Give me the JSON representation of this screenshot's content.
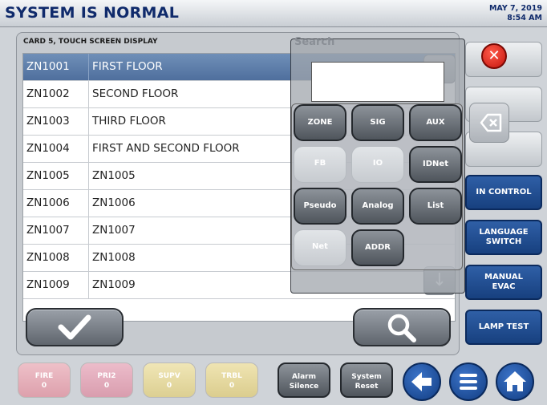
{
  "header": {
    "status": "SYSTEM IS NORMAL",
    "date": "MAY 7, 2019",
    "time": "8:54 AM"
  },
  "panel": {
    "title": "CARD 5, TOUCH SCREEN DISPLAY",
    "rows": [
      {
        "id": "ZN1001",
        "desc": "FIRST FLOOR",
        "selected": true
      },
      {
        "id": "ZN1002",
        "desc": "SECOND FLOOR"
      },
      {
        "id": "ZN1003",
        "desc": "THIRD FLOOR"
      },
      {
        "id": "ZN1004",
        "desc": "FIRST AND SECOND FLOOR"
      },
      {
        "id": "ZN1005",
        "desc": "ZN1005"
      },
      {
        "id": "ZN1006",
        "desc": "ZN1006"
      },
      {
        "id": "ZN1007",
        "desc": "ZN1007"
      },
      {
        "id": "ZN1008",
        "desc": "ZN1008"
      },
      {
        "id": "ZN1009",
        "desc": "ZN1009"
      }
    ]
  },
  "search": {
    "label": "Search",
    "value": "",
    "keys": [
      {
        "label": "ZONE",
        "enabled": true
      },
      {
        "label": "SIG",
        "enabled": true
      },
      {
        "label": "AUX",
        "enabled": true
      },
      {
        "label": "FB",
        "enabled": false
      },
      {
        "label": "IO",
        "enabled": false
      },
      {
        "label": "IDNet",
        "enabled": true
      },
      {
        "label": "Pseudo",
        "enabled": true
      },
      {
        "label": "Analog",
        "enabled": true
      },
      {
        "label": "List",
        "enabled": true
      },
      {
        "label": "Net",
        "enabled": false
      },
      {
        "label": "ADDR",
        "enabled": true
      }
    ]
  },
  "right_buttons": {
    "in_control": "IN CONTROL",
    "language_switch_1": "LANGUAGE",
    "language_switch_2": "SWITCH",
    "manual_evac_1": "MANUAL",
    "manual_evac_2": "EVAC",
    "lamp_test": "LAMP TEST"
  },
  "footer": {
    "fire_label": "FIRE",
    "fire_count": "0",
    "pri2_label": "PRI2",
    "pri2_count": "0",
    "supv_label": "SUPV",
    "supv_count": "0",
    "trbl_label": "TRBL",
    "trbl_count": "0",
    "alarm_silence_1": "Alarm",
    "alarm_silence_2": "Silence",
    "system_reset_1": "System",
    "system_reset_2": "Reset"
  },
  "colors": {
    "fire": "#e6a9b3",
    "pri2": "#e2a6b6",
    "supv": "#e8dca2",
    "trbl": "#e6d99e",
    "accent_blue": "#17407f"
  },
  "icons": [
    "check-icon",
    "search-icon",
    "close-icon",
    "backspace-icon",
    "back-arrow-icon",
    "menu-icon",
    "home-icon",
    "scroll-down-icon"
  ]
}
